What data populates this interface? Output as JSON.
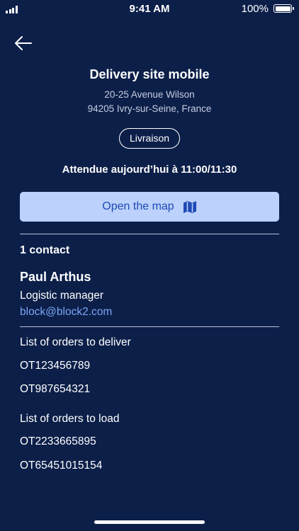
{
  "status_bar": {
    "time": "9:41 AM",
    "battery": "100%"
  },
  "site": {
    "title": "Delivery site mobile",
    "address_line1": "20-25 Avenue Wilson",
    "address_line2": "94205 Ivry-sur-Seine, France",
    "type_badge": "Livraison",
    "expected": "Attendue aujourd’hui à 11:00/11:30"
  },
  "map_button": {
    "label": "Open the map",
    "icon": "map-icon"
  },
  "contacts": {
    "count_label": "1 contact",
    "items": [
      {
        "name": "Paul Arthus",
        "role": "Logistic manager",
        "email": "block@block2.com"
      }
    ]
  },
  "orders": {
    "deliver_label": "List of orders to deliver",
    "deliver": [
      "OT123456789",
      "OT987654321"
    ],
    "load_label": "List of orders to load",
    "load": [
      "OT2233665895",
      "OT65451015154"
    ]
  },
  "colors": {
    "background": "#0c1f49",
    "button": "#bcd1fb",
    "button_text": "#1d4bb5",
    "link": "#7aa6f6"
  }
}
